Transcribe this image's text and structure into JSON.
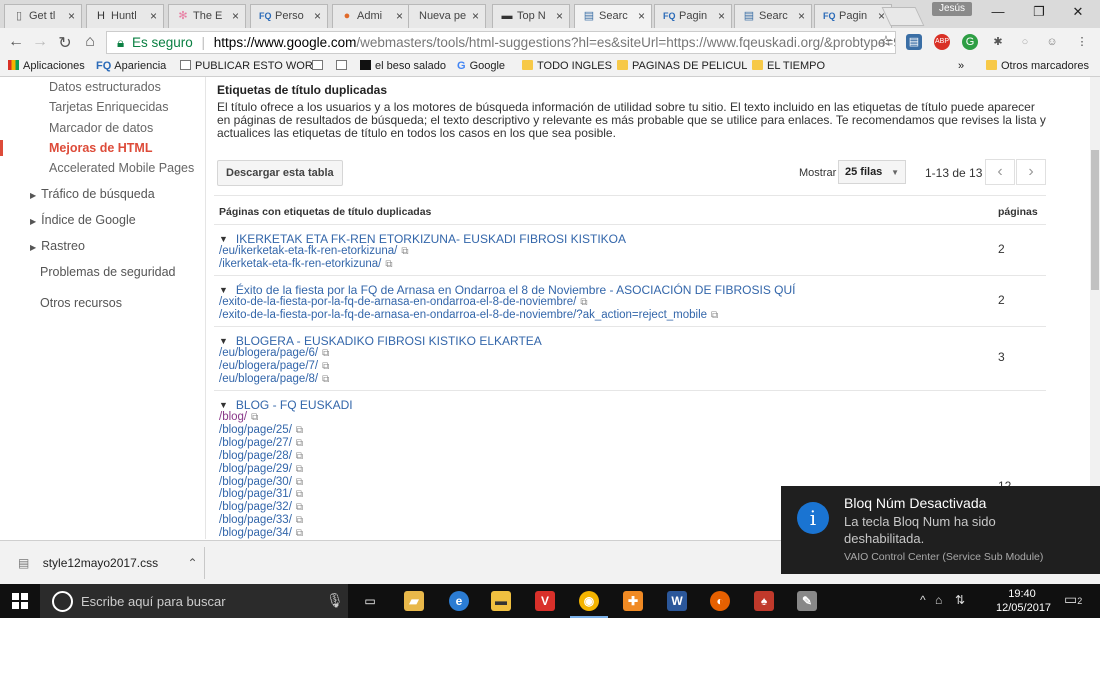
{
  "browser": {
    "tabs": [
      {
        "icon": "page-icon",
        "title": "Get tl",
        "color": "#666"
      },
      {
        "icon": "hunt-icon",
        "title": "Huntl",
        "color": "#333"
      },
      {
        "icon": "flower-icon",
        "title": "The E",
        "color": "#e87aa0"
      },
      {
        "icon": "fq-icon",
        "title": "Perso",
        "color": "#2a6ab8"
      },
      {
        "icon": "admin-icon",
        "title": "Admi",
        "color": "#e06a2a"
      },
      {
        "icon": "none",
        "title": "Nueva pe",
        "color": "#666"
      },
      {
        "icon": "wdg-icon",
        "title": "Top N",
        "color": "#333"
      },
      {
        "icon": "search-console-icon",
        "title": "Searc",
        "color": "#3a6ea5"
      },
      {
        "icon": "fq-icon",
        "title": "Pagin",
        "color": "#2a6ab8"
      },
      {
        "icon": "search-console-icon",
        "title": "Searc",
        "color": "#3a6ea5"
      },
      {
        "icon": "fq-icon",
        "title": "Pagin",
        "color": "#2a6ab8"
      }
    ],
    "user": "Jesús",
    "url_secure_label": "Es seguro",
    "url_host": "https://www.google.com",
    "url_rest": "/webmasters/tools/html-suggestions?hl=es&siteUrl=https://www.fqeuskadi.org/&probtype=9&pl",
    "bookmarks": [
      "Aplicaciones",
      "Apariencia",
      "PUBLICAR ESTO WOR",
      "",
      "",
      "el beso salado",
      "Google",
      "TODO INGLES",
      "PAGINAS DE PELICUL",
      "EL TIEMPO",
      "»",
      "Otros marcadores"
    ]
  },
  "sidebar": {
    "sub_items": [
      "Datos estructurados",
      "Tarjetas Enriquecidas",
      "Marcador de datos",
      "Mejoras de HTML",
      "Accelerated Mobile Pages"
    ],
    "main_items": [
      "Tráfico de búsqueda",
      "Índice de Google",
      "Rastreo",
      "Problemas de seguridad",
      "Otros recursos"
    ]
  },
  "content": {
    "heading": "Etiquetas de título duplicadas",
    "description": "El título ofrece a los usuarios y a los motores de búsqueda información de utilidad sobre tu sitio. El texto incluido en las etiquetas de título puede aparecer en páginas de resultados de búsqueda; el texto descriptivo y relevante es más probable que se utilice para enlaces. Te recomendamos que revises la lista y actualices las etiquetas de título en todos los casos en los que sea posible.",
    "download_button": "Descargar esta tabla",
    "show_label": "Mostrar",
    "rows_select": "25 filas",
    "range": "1-13 de 13",
    "col_pages": "Páginas con etiquetas de título duplicadas",
    "col_count": "páginas",
    "groups": [
      {
        "title": "IKERKETAK ETA FK-REN ETORKIZUNA- EUSKADI FIBROSI KISTIKOA",
        "count": "2",
        "urls": [
          "/eu/ikerketak-eta-fk-ren-etorkizuna/",
          "/ikerketak-eta-fk-ren-etorkizuna/"
        ]
      },
      {
        "title": "Éxito de la fiesta por la FQ de Arnasa en Ondarroa el 8 de Noviembre - ASOCIACIÓN DE FIBROSIS QUÍ",
        "count": "2",
        "urls": [
          "/exito-de-la-fiesta-por-la-fq-de-arnasa-en-ondarroa-el-8-de-noviembre/",
          "/exito-de-la-fiesta-por-la-fq-de-arnasa-en-ondarroa-el-8-de-noviembre/?ak_action=reject_mobile"
        ]
      },
      {
        "title": "BLOGERA - EUSKADIKO FIBROSI KISTIKO ELKARTEA",
        "count": "3",
        "urls": [
          "/eu/blogera/page/6/",
          "/eu/blogera/page/7/",
          "/eu/blogera/page/8/"
        ]
      },
      {
        "title": "BLOG - FQ EUSKADI",
        "count": "12",
        "urls": [
          "/blog/",
          "/blog/page/25/",
          "/blog/page/27/",
          "/blog/page/28/",
          "/blog/page/29/",
          "/blog/page/30/",
          "/blog/page/31/",
          "/blog/page/32/",
          "/blog/page/33/",
          "/blog/page/34/"
        ]
      }
    ]
  },
  "downloads": {
    "file": "style12mayo2017.css"
  },
  "notification": {
    "title": "Bloq Núm Desactivada",
    "body": "La tecla Bloq Num ha sido deshabilitada.",
    "source": "VAIO Control Center (Service Sub Module)"
  },
  "taskbar": {
    "search_placeholder": "Escribe aquí para buscar",
    "time": "19:40",
    "date": "12/05/2017",
    "notifications_count": "2"
  }
}
